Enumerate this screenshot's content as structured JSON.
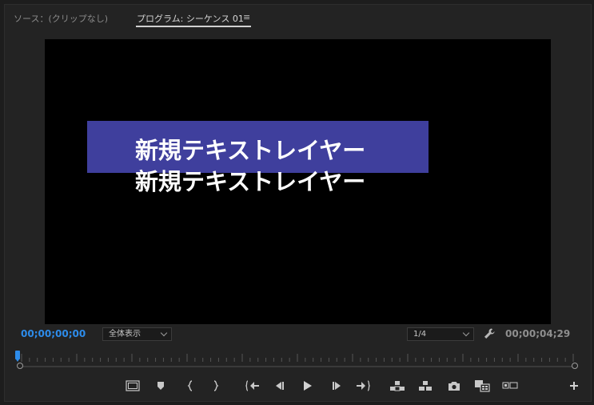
{
  "tabs": {
    "source": "ソース：(クリップなし)",
    "program": "プログラム: シーケンス 01",
    "menu": "≡"
  },
  "viewer": {
    "title_line1": "新規テキストレイヤー",
    "title_line2": "新規テキストレイヤー",
    "bar_color": "#3f3f9d"
  },
  "controls": {
    "timecode_current": "00;00;00;00",
    "timecode_duration": "00;00;04;29",
    "zoom_value": "全体表示",
    "resolution_value": "1/4"
  },
  "colors": {
    "accent": "#2d8ceb",
    "panel": "#232323"
  },
  "transport_icons": [
    "safe-margins-icon",
    "add-marker-icon",
    "mark-in-icon",
    "mark-out-icon",
    "go-to-in-icon",
    "step-back-icon",
    "play-icon",
    "step-forward-icon",
    "go-to-out-icon",
    "lift-icon",
    "extract-icon",
    "export-frame-icon",
    "comparison-view-icon",
    "vr-video-icon",
    "button-editor-icon"
  ]
}
